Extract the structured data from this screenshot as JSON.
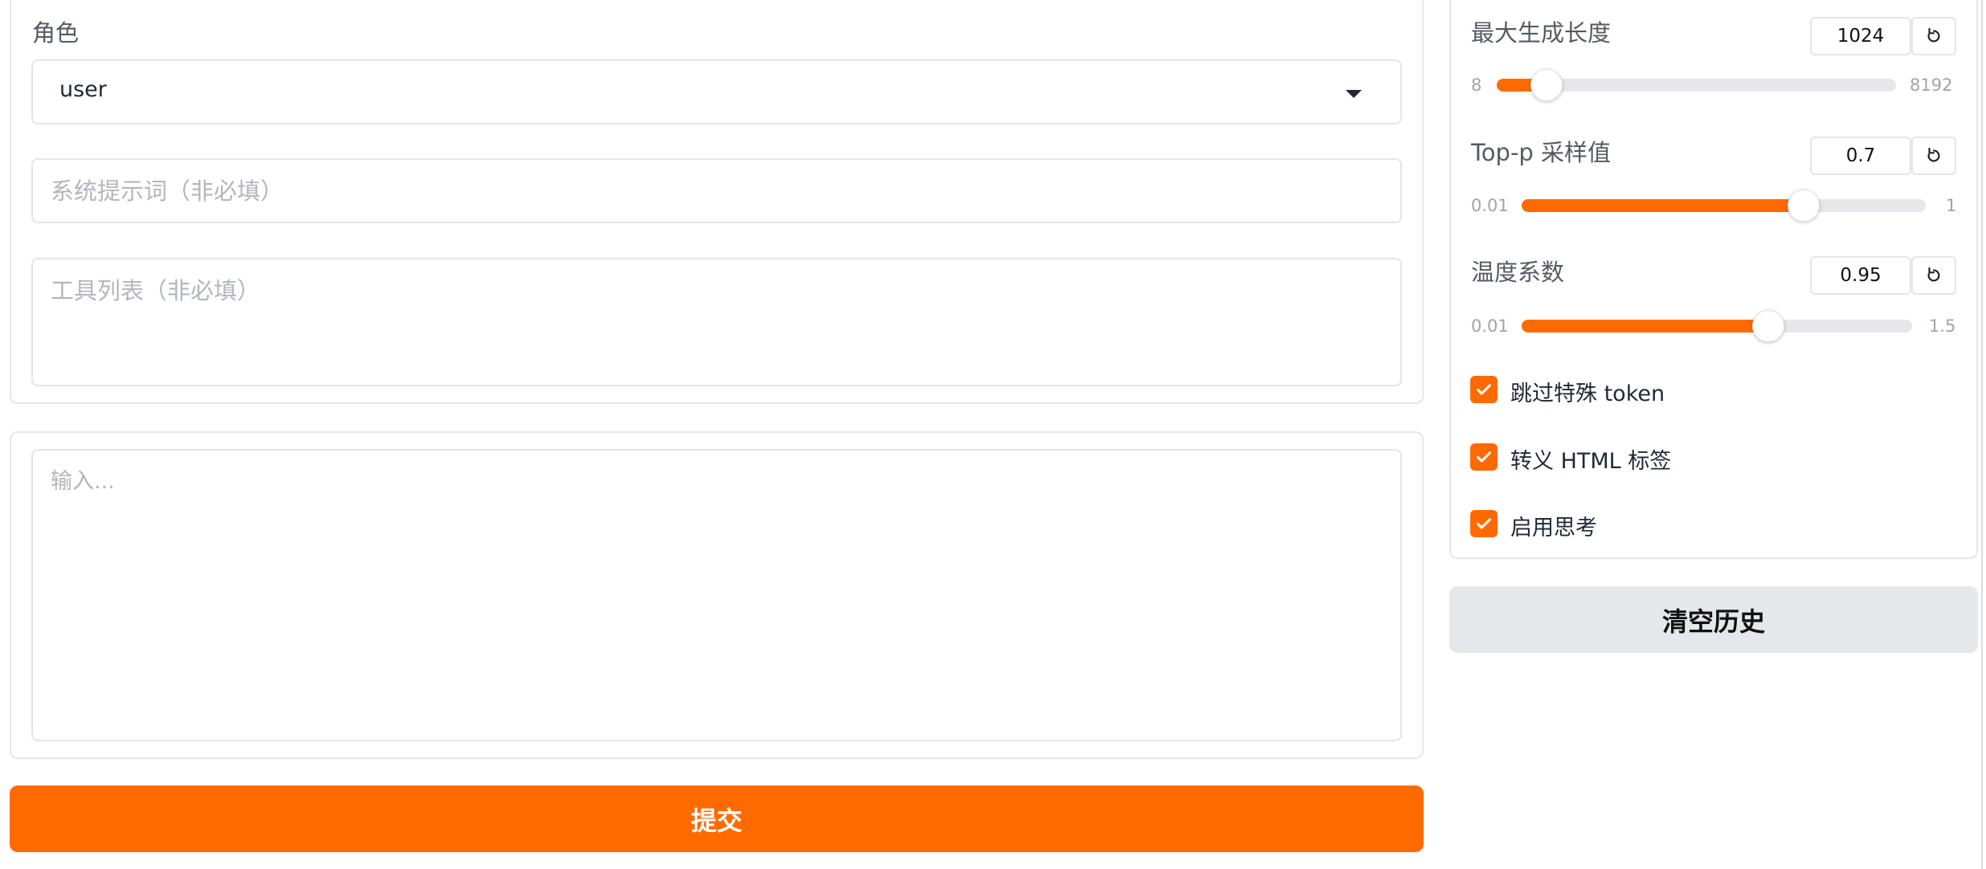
{
  "left": {
    "role": {
      "label": "角色",
      "selected": "user"
    },
    "system_prompt": {
      "placeholder": "系统提示词（非必填）"
    },
    "tools": {
      "placeholder": "工具列表（非必填）"
    },
    "input": {
      "placeholder": "输入..."
    },
    "submit_label": "提交"
  },
  "right": {
    "sliders": [
      {
        "label": "最大生成长度",
        "value": "1024",
        "min": "8",
        "max": "8192",
        "fraction": 0.124
      },
      {
        "label": "Top-p 采样值",
        "value": "0.7",
        "min": "0.01",
        "max": "1",
        "fraction": 0.697
      },
      {
        "label": "温度系数",
        "value": "0.95",
        "min": "0.01",
        "max": "1.5",
        "fraction": 0.631
      }
    ],
    "checkboxes": [
      {
        "label": "跳过特殊 token",
        "checked": true
      },
      {
        "label": "转义 HTML 标签",
        "checked": true
      },
      {
        "label": "启用思考",
        "checked": true
      }
    ],
    "clear_label": "清空历史"
  },
  "colors": {
    "accent": "#ff6a00",
    "secondary_button": "#e5e7eb"
  },
  "icons": {
    "dropdown": "chevron-down-icon",
    "reset": "reset-icon",
    "check": "check-icon"
  }
}
